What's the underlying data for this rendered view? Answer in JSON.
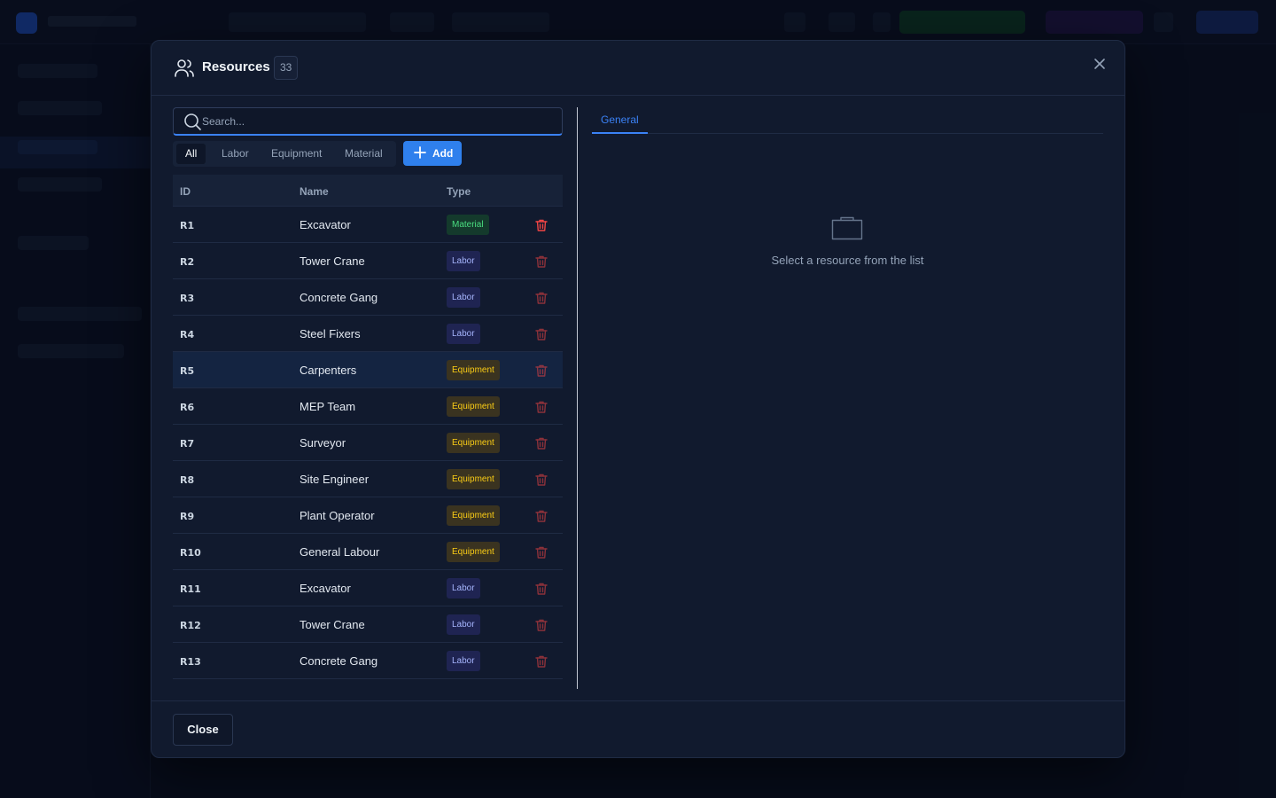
{
  "modal": {
    "title": "Resources",
    "count": "33",
    "search_placeholder": "Search...",
    "filters": [
      "All",
      "Labor",
      "Equipment",
      "Material"
    ],
    "active_filter": "All",
    "add_label": "Add",
    "columns": {
      "id": "ID",
      "name": "Name",
      "type": "Type"
    },
    "rows": [
      {
        "id": "R1",
        "name": "Excavator",
        "type": "Material"
      },
      {
        "id": "R2",
        "name": "Tower Crane",
        "type": "Labor"
      },
      {
        "id": "R3",
        "name": "Concrete Gang",
        "type": "Labor"
      },
      {
        "id": "R4",
        "name": "Steel Fixers",
        "type": "Labor"
      },
      {
        "id": "R5",
        "name": "Carpenters",
        "type": "Equipment",
        "selected": true
      },
      {
        "id": "R6",
        "name": "MEP Team",
        "type": "Equipment"
      },
      {
        "id": "R7",
        "name": "Surveyor",
        "type": "Equipment"
      },
      {
        "id": "R8",
        "name": "Site Engineer",
        "type": "Equipment"
      },
      {
        "id": "R9",
        "name": "Plant Operator",
        "type": "Equipment"
      },
      {
        "id": "R10",
        "name": "General Labour",
        "type": "Equipment"
      },
      {
        "id": "R11",
        "name": "Excavator",
        "type": "Labor"
      },
      {
        "id": "R12",
        "name": "Tower Crane",
        "type": "Labor"
      },
      {
        "id": "R13",
        "name": "Concrete Gang",
        "type": "Labor"
      }
    ],
    "detail_tab": "General",
    "empty_message": "Select a resource from the list",
    "close_label": "Close"
  },
  "colors": {
    "accent": "#3b82f6",
    "material": "#4ade80",
    "labor": "#a5b4fc",
    "equipment": "#facc15",
    "danger": "#ef4444"
  },
  "icons": {
    "header": "users-icon",
    "search": "search-icon",
    "add": "plus-icon",
    "row_action": "trash-icon",
    "empty": "folder-icon",
    "close": "close-icon"
  }
}
